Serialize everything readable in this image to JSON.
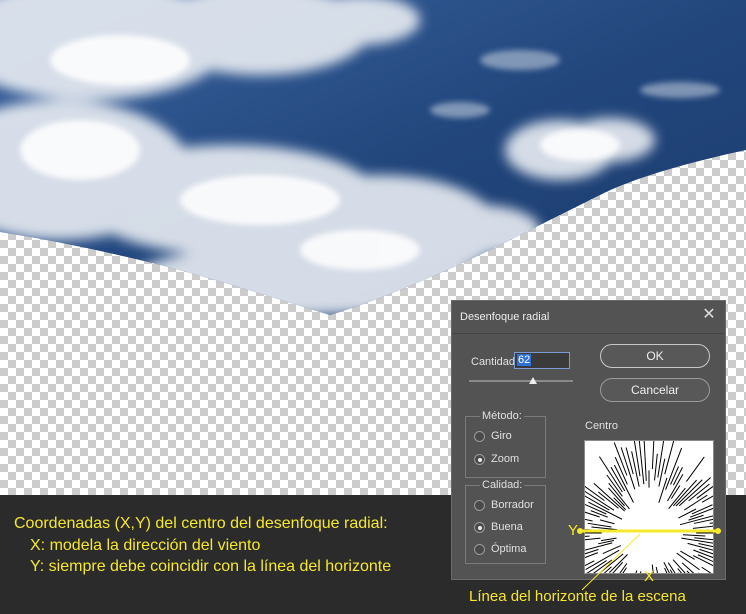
{
  "dialog": {
    "title": "Desenfoque radial",
    "amount_label": "Cantidad",
    "amount_value": "62",
    "amount_slider_fraction": 0.62,
    "ok_label": "OK",
    "cancel_label": "Cancelar",
    "method": {
      "title": "Método:",
      "options": [
        "Giro",
        "Zoom"
      ],
      "selected": "Zoom"
    },
    "quality": {
      "title": "Calidad:",
      "options": [
        "Borrador",
        "Buena",
        "Óptima"
      ],
      "selected": "Buena"
    },
    "center_label": "Centro"
  },
  "annotations": {
    "line1": "Coordenadas (X,Y) del centro del desenfoque radial:",
    "line2": "X: modela la dirección del viento",
    "line3": "Y: siempre debe coincidir con la línea del horizonte",
    "y_marker": "Y",
    "x_marker": "X",
    "horizon_caption": "Línea del horizonte de la escena"
  },
  "colors": {
    "annotation": "#f6e82b",
    "dialog_bg": "#535353",
    "bar_bg": "#2b2b2b",
    "sky_top": "#22477d"
  }
}
